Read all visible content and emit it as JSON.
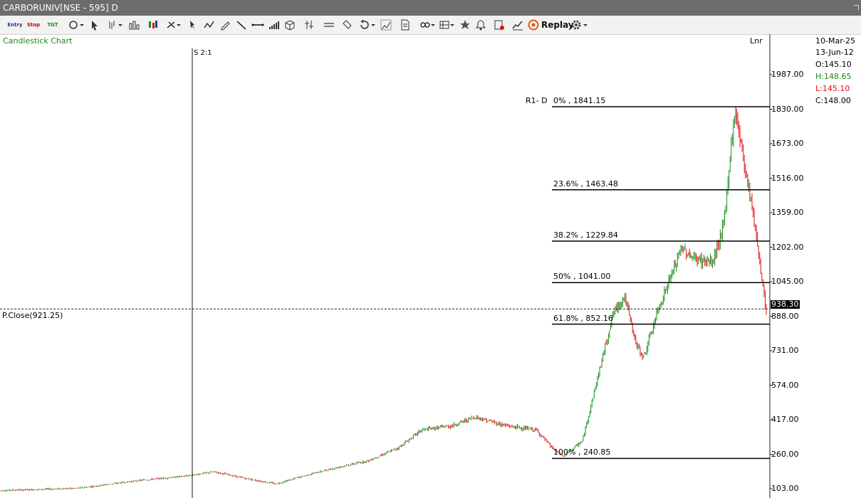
{
  "window": {
    "title": "CARBORUNIV[NSE - 595] D"
  },
  "toolbar": {
    "entry_label": "Entry",
    "stop_label": "Stop",
    "tgt_label": "TGT",
    "replay_label": "Replay"
  },
  "chart": {
    "type_label": "Candlestick Chart",
    "scale_label": "Lnr",
    "split_label": "S 2:1",
    "prev_close_label": "P.Close(921.25)",
    "current_price_label": "938.30",
    "info": {
      "date_end": "10-Mar-25",
      "date_start": "13-Jun-12",
      "open": "O:145.10",
      "high": "H:148.65",
      "low": "L:145.10",
      "close": "C:148.00"
    },
    "colors": {
      "up": "#1a8a1a",
      "down": "#e01010",
      "high": "#1a8a1a",
      "low": "#e01010"
    }
  },
  "fibonacci": {
    "label": "R1- D",
    "levels": [
      {
        "label": "0%  , 1841.15",
        "price": 1841.15
      },
      {
        "label": "23.6%  , 1463.48",
        "price": 1463.48
      },
      {
        "label": "38.2%  , 1229.84",
        "price": 1229.84
      },
      {
        "label": "50%  , 1041.00",
        "price": 1041.0
      },
      {
        "label": "61.8%  , 852.16",
        "price": 852.16
      },
      {
        "label": "100%  , 240.85",
        "price": 240.85
      }
    ]
  },
  "chart_data": {
    "type": "candlestick",
    "title": "Candlestick Chart",
    "y_ticks": [
      1987.0,
      1830.0,
      1673.0,
      1516.0,
      1359.0,
      1202.0,
      1045.0,
      888.0,
      731.0,
      574.0,
      417.0,
      260.0,
      103.0
    ],
    "ylim": [
      90,
      2090
    ],
    "prev_close": 921.25,
    "last": 938.3,
    "price_path": [
      [
        0.0,
        95
      ],
      [
        0.1,
        105
      ],
      [
        0.18,
        140
      ],
      [
        0.24,
        160
      ],
      [
        0.28,
        180
      ],
      [
        0.32,
        150
      ],
      [
        0.36,
        125
      ],
      [
        0.4,
        165
      ],
      [
        0.44,
        200
      ],
      [
        0.48,
        230
      ],
      [
        0.52,
        290
      ],
      [
        0.55,
        370
      ],
      [
        0.59,
        390
      ],
      [
        0.62,
        430
      ],
      [
        0.66,
        390
      ],
      [
        0.7,
        370
      ],
      [
        0.72,
        290
      ],
      [
        0.735,
        250
      ],
      [
        0.76,
        320
      ],
      [
        0.8,
        900
      ],
      [
        0.815,
        980
      ],
      [
        0.83,
        760
      ],
      [
        0.84,
        700
      ],
      [
        0.86,
        930
      ],
      [
        0.89,
        1200
      ],
      [
        0.905,
        1150
      ],
      [
        0.93,
        1130
      ],
      [
        0.945,
        1310
      ],
      [
        0.955,
        1700
      ],
      [
        0.96,
        1820
      ],
      [
        0.975,
        1510
      ],
      [
        0.98,
        1420
      ],
      [
        0.99,
        1180
      ],
      [
        1.0,
        890
      ]
    ]
  }
}
